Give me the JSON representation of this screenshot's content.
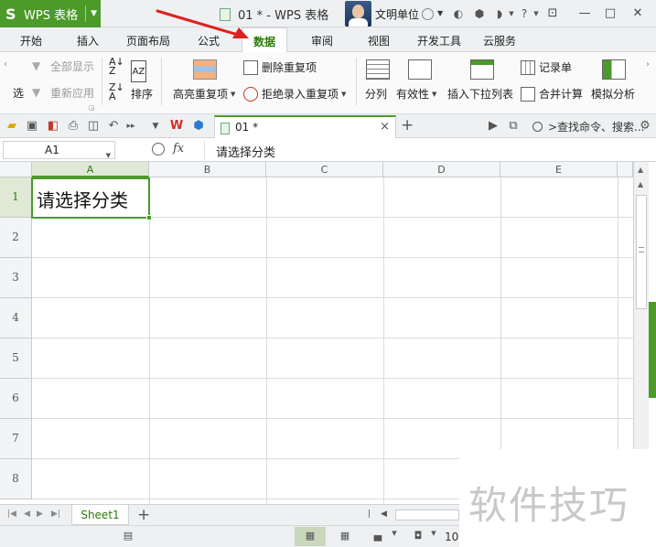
{
  "titlebar": {
    "app_name": "WPS 表格",
    "app_logo": "S",
    "doc_title": "01 * - WPS 表格",
    "user_name": "文明单位"
  },
  "ribbon_tabs": [
    "开始",
    "插入",
    "页面布局",
    "公式",
    "数据",
    "审阅",
    "视图",
    "开发工具",
    "云服务"
  ],
  "active_tab": "数据",
  "ribbon": {
    "filter_partial": "选",
    "show_all": "全部显示",
    "reapply": "重新应用",
    "sort": "排序",
    "highlight_dup": "高亮重复项",
    "delete_dup": "删除重复项",
    "reject_dup": "拒绝录入重复项",
    "split": "分列",
    "validity": "有效性",
    "insert_dropdown": "插入下拉列表",
    "record_sheet": "记录单",
    "merge_calc": "合并计算",
    "simulate": "模拟分析"
  },
  "doc_tab": {
    "label": "01 *",
    "close": "×",
    "add": "+"
  },
  "search": {
    "placeholder": ">查找命令、搜索..."
  },
  "formula_bar": {
    "name_box": "A1",
    "fx": "fx",
    "content": "请选择分类"
  },
  "grid": {
    "columns": [
      "A",
      "B",
      "C",
      "D",
      "E"
    ],
    "rows": [
      "1",
      "2",
      "3",
      "4",
      "5",
      "6",
      "7",
      "8"
    ],
    "selected_cell": "A1",
    "cells": {
      "A1": "请选择分类"
    }
  },
  "sheets": {
    "tabs": [
      "Sheet1"
    ],
    "add": "+"
  },
  "status": {
    "zoom": "10"
  },
  "watermark": "软件技巧",
  "colors": {
    "accent": "#4c9a2a",
    "annotation": "#e02020"
  }
}
